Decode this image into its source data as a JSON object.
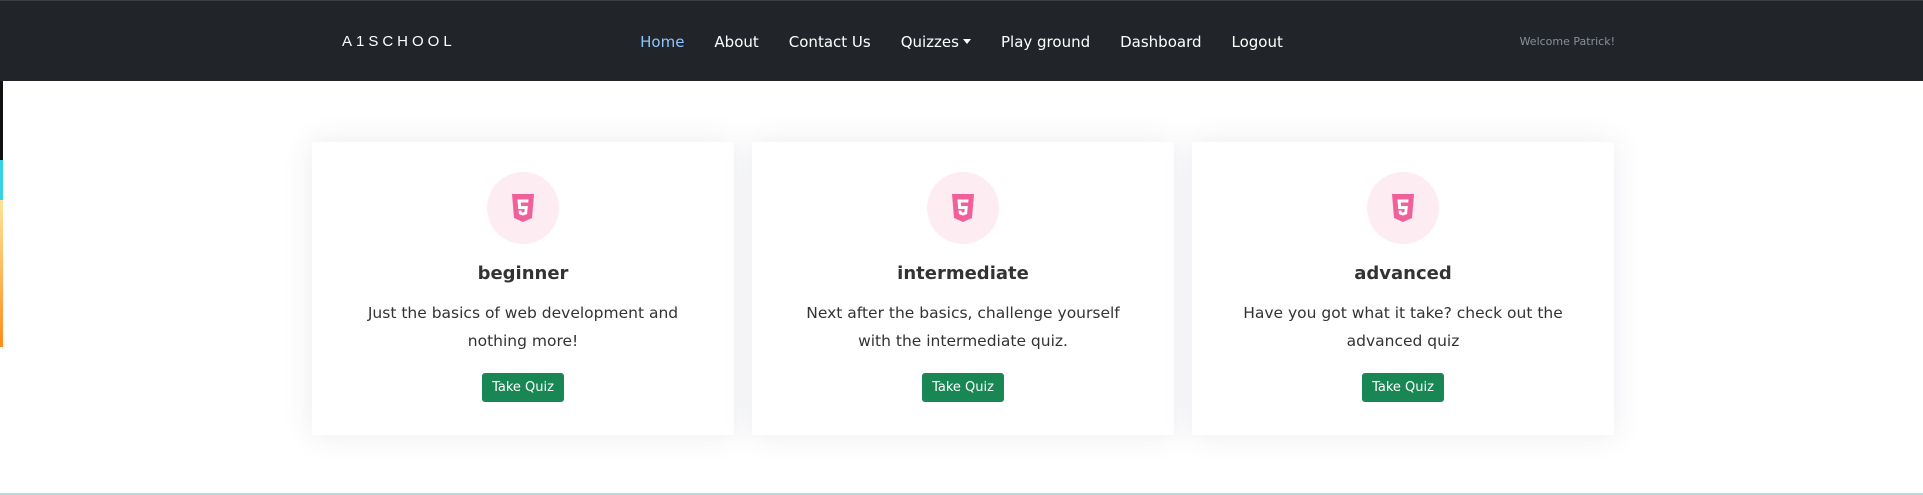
{
  "navbar": {
    "brand": "A1SCHOOL",
    "items": [
      {
        "label": "Home",
        "active": true
      },
      {
        "label": "About"
      },
      {
        "label": "Contact Us"
      },
      {
        "label": "Quizzes",
        "dropdown": true
      },
      {
        "label": "Play ground"
      },
      {
        "label": "Dashboard"
      },
      {
        "label": "Logout"
      }
    ],
    "welcome": "Welcome Patrick!"
  },
  "cards": [
    {
      "icon": "html5-icon",
      "title": "beginner",
      "text": "Just the basics of web development and nothing more!",
      "button": "Take Quiz"
    },
    {
      "icon": "html5-icon",
      "title": "intermediate",
      "text": "Next after the basics, challenge yourself with the intermediate quiz.",
      "button": "Take Quiz"
    },
    {
      "icon": "html5-icon",
      "title": "advanced",
      "text": "Have you got what it take? check out the advanced quiz",
      "button": "Take Quiz"
    }
  ],
  "colors": {
    "navbar_bg": "#212529",
    "active_link": "#8ec5ff",
    "button_green": "#198754",
    "icon_pink": "#f0609a",
    "icon_bg": "#fdecf1"
  }
}
